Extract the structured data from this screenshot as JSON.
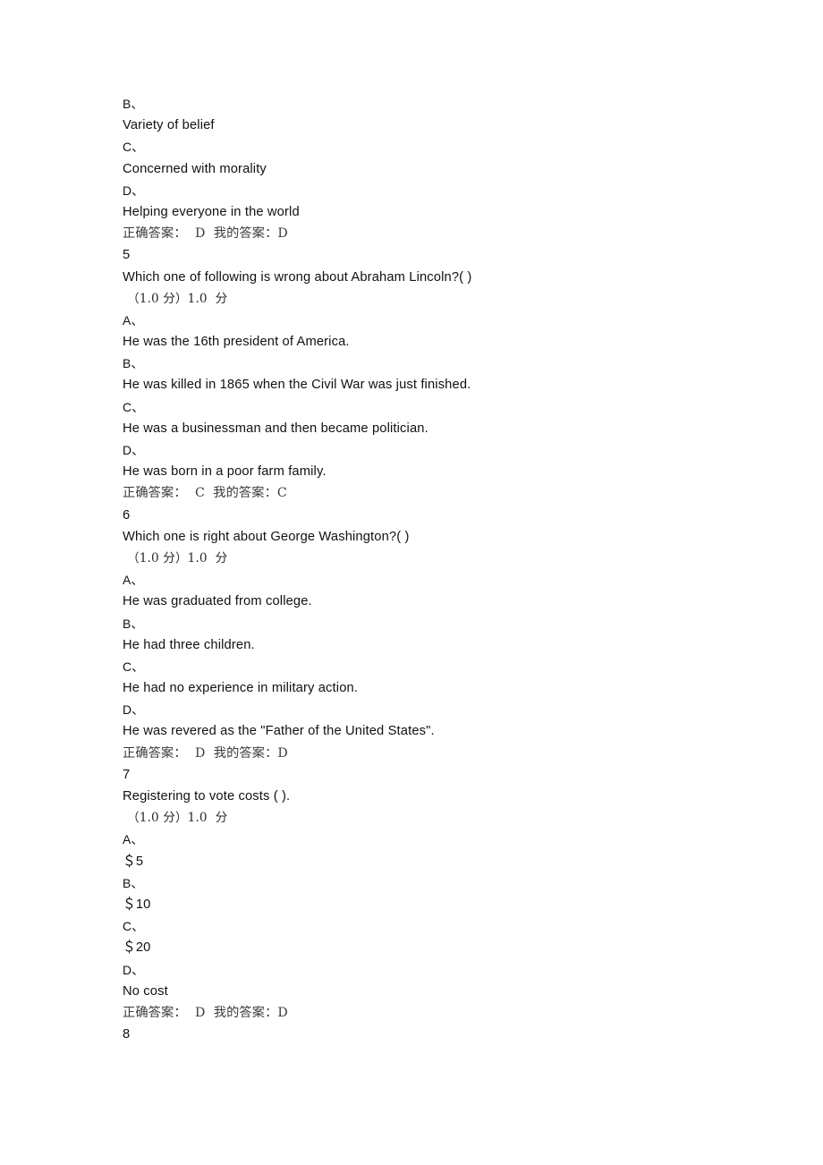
{
  "page": {
    "background_color": "#ffffff",
    "text_color": "#111111",
    "muted_text_color": "#3a3a3a"
  },
  "labels": {
    "correct_answer_prefix": "正确答案：",
    "my_answer_prefix": "我的答案：",
    "score_open_paren": "（",
    "score_close_paren": "）",
    "score_unit": "分",
    "option_separator": "、"
  },
  "lines": [
    {
      "kind": "optlabel",
      "text": "B、"
    },
    {
      "kind": "opttext",
      "text": "Variety of belief"
    },
    {
      "kind": "optlabel",
      "text": "C、"
    },
    {
      "kind": "opttext",
      "text": "Concerned with morality"
    },
    {
      "kind": "optlabel",
      "text": "D、"
    },
    {
      "kind": "opttext",
      "text": "Helping everyone in the world"
    },
    {
      "kind": "answer",
      "text": "正确答案：  D  我的答案：D"
    },
    {
      "kind": "qnum",
      "text": "5"
    },
    {
      "kind": "stem",
      "text": "Which one of following is wrong about Abraham Lincoln?( )"
    },
    {
      "kind": "score",
      "text": "（1.0 分）1.0  分"
    },
    {
      "kind": "optlabel",
      "text": "A、"
    },
    {
      "kind": "opttext",
      "text": "He was the 16th president of America."
    },
    {
      "kind": "optlabel",
      "text": "B、"
    },
    {
      "kind": "opttext",
      "text": "He was killed in 1865 when the Civil War was just finished."
    },
    {
      "kind": "optlabel",
      "text": "C、"
    },
    {
      "kind": "opttext",
      "text": "He was a businessman and then became politician."
    },
    {
      "kind": "optlabel",
      "text": "D、"
    },
    {
      "kind": "opttext",
      "text": "He was born in a poor farm family."
    },
    {
      "kind": "answer",
      "text": "正确答案：  C  我的答案：C"
    },
    {
      "kind": "qnum",
      "text": "6"
    },
    {
      "kind": "stem",
      "text": "Which one is right about George Washington?( )"
    },
    {
      "kind": "score",
      "text": "（1.0 分）1.0  分"
    },
    {
      "kind": "optlabel",
      "text": "A、"
    },
    {
      "kind": "opttext",
      "text": "He was graduated from college."
    },
    {
      "kind": "optlabel",
      "text": "B、"
    },
    {
      "kind": "opttext",
      "text": "He had three children."
    },
    {
      "kind": "optlabel",
      "text": "C、"
    },
    {
      "kind": "opttext",
      "text": "He had no experience in military action."
    },
    {
      "kind": "optlabel",
      "text": "D、"
    },
    {
      "kind": "opttext",
      "text": "He was revered as the \"Father of the United States\"."
    },
    {
      "kind": "answer",
      "text": "正确答案：  D  我的答案：D"
    },
    {
      "kind": "qnum",
      "text": "7"
    },
    {
      "kind": "stem",
      "text": "Registering to vote costs ( )."
    },
    {
      "kind": "score",
      "text": "（1.0 分）1.0  分"
    },
    {
      "kind": "optlabel",
      "text": "A、"
    },
    {
      "kind": "opttext",
      "text": "＄5"
    },
    {
      "kind": "optlabel",
      "text": "B、"
    },
    {
      "kind": "opttext",
      "text": "＄10"
    },
    {
      "kind": "optlabel",
      "text": "C、"
    },
    {
      "kind": "opttext",
      "text": "＄20"
    },
    {
      "kind": "optlabel",
      "text": "D、"
    },
    {
      "kind": "opttext",
      "text": "No cost"
    },
    {
      "kind": "answer",
      "text": "正确答案：  D  我的答案：D"
    },
    {
      "kind": "qnum",
      "text": "8"
    }
  ],
  "questions": [
    {
      "number": "5",
      "stem": "Which one of following is wrong about Abraham Lincoln?( )",
      "score_line": "（1.0 分）1.0  分",
      "score_max": "1.0",
      "score_earned": "1.0",
      "options": [
        {
          "label": "A、",
          "text": "He was the 16th president of America."
        },
        {
          "label": "B、",
          "text": "He was killed in 1865 when the Civil War was just finished."
        },
        {
          "label": "C、",
          "text": "He was a businessman and then became politician."
        },
        {
          "label": "D、",
          "text": "He was born in a poor farm family."
        }
      ],
      "correct_answer": "C",
      "my_answer": "C"
    },
    {
      "number": "6",
      "stem": "Which one is right about George Washington?( )",
      "score_line": "（1.0 分）1.0  分",
      "score_max": "1.0",
      "score_earned": "1.0",
      "options": [
        {
          "label": "A、",
          "text": "He was graduated from college."
        },
        {
          "label": "B、",
          "text": "He had three children."
        },
        {
          "label": "C、",
          "text": "He had no experience in military action."
        },
        {
          "label": "D、",
          "text": "He was revered as the \"Father of the United States\"."
        }
      ],
      "correct_answer": "D",
      "my_answer": "D"
    },
    {
      "number": "7",
      "stem": "Registering to vote costs ( ).",
      "score_line": "（1.0 分）1.0  分",
      "score_max": "1.0",
      "score_earned": "1.0",
      "options": [
        {
          "label": "A、",
          "text": "＄5"
        },
        {
          "label": "B、",
          "text": "＄10"
        },
        {
          "label": "C、",
          "text": "＄20"
        },
        {
          "label": "D、",
          "text": "No cost"
        }
      ],
      "correct_answer": "D",
      "my_answer": "D"
    },
    {
      "number": "8",
      "stem": "",
      "score_line": "",
      "options": [],
      "correct_answer": "",
      "my_answer": ""
    }
  ],
  "partial_question_above": {
    "options": [
      {
        "label": "B、",
        "text": "Variety of belief"
      },
      {
        "label": "C、",
        "text": "Concerned with morality"
      },
      {
        "label": "D、",
        "text": "Helping everyone in the world"
      }
    ],
    "correct_answer": "D",
    "my_answer": "D"
  }
}
